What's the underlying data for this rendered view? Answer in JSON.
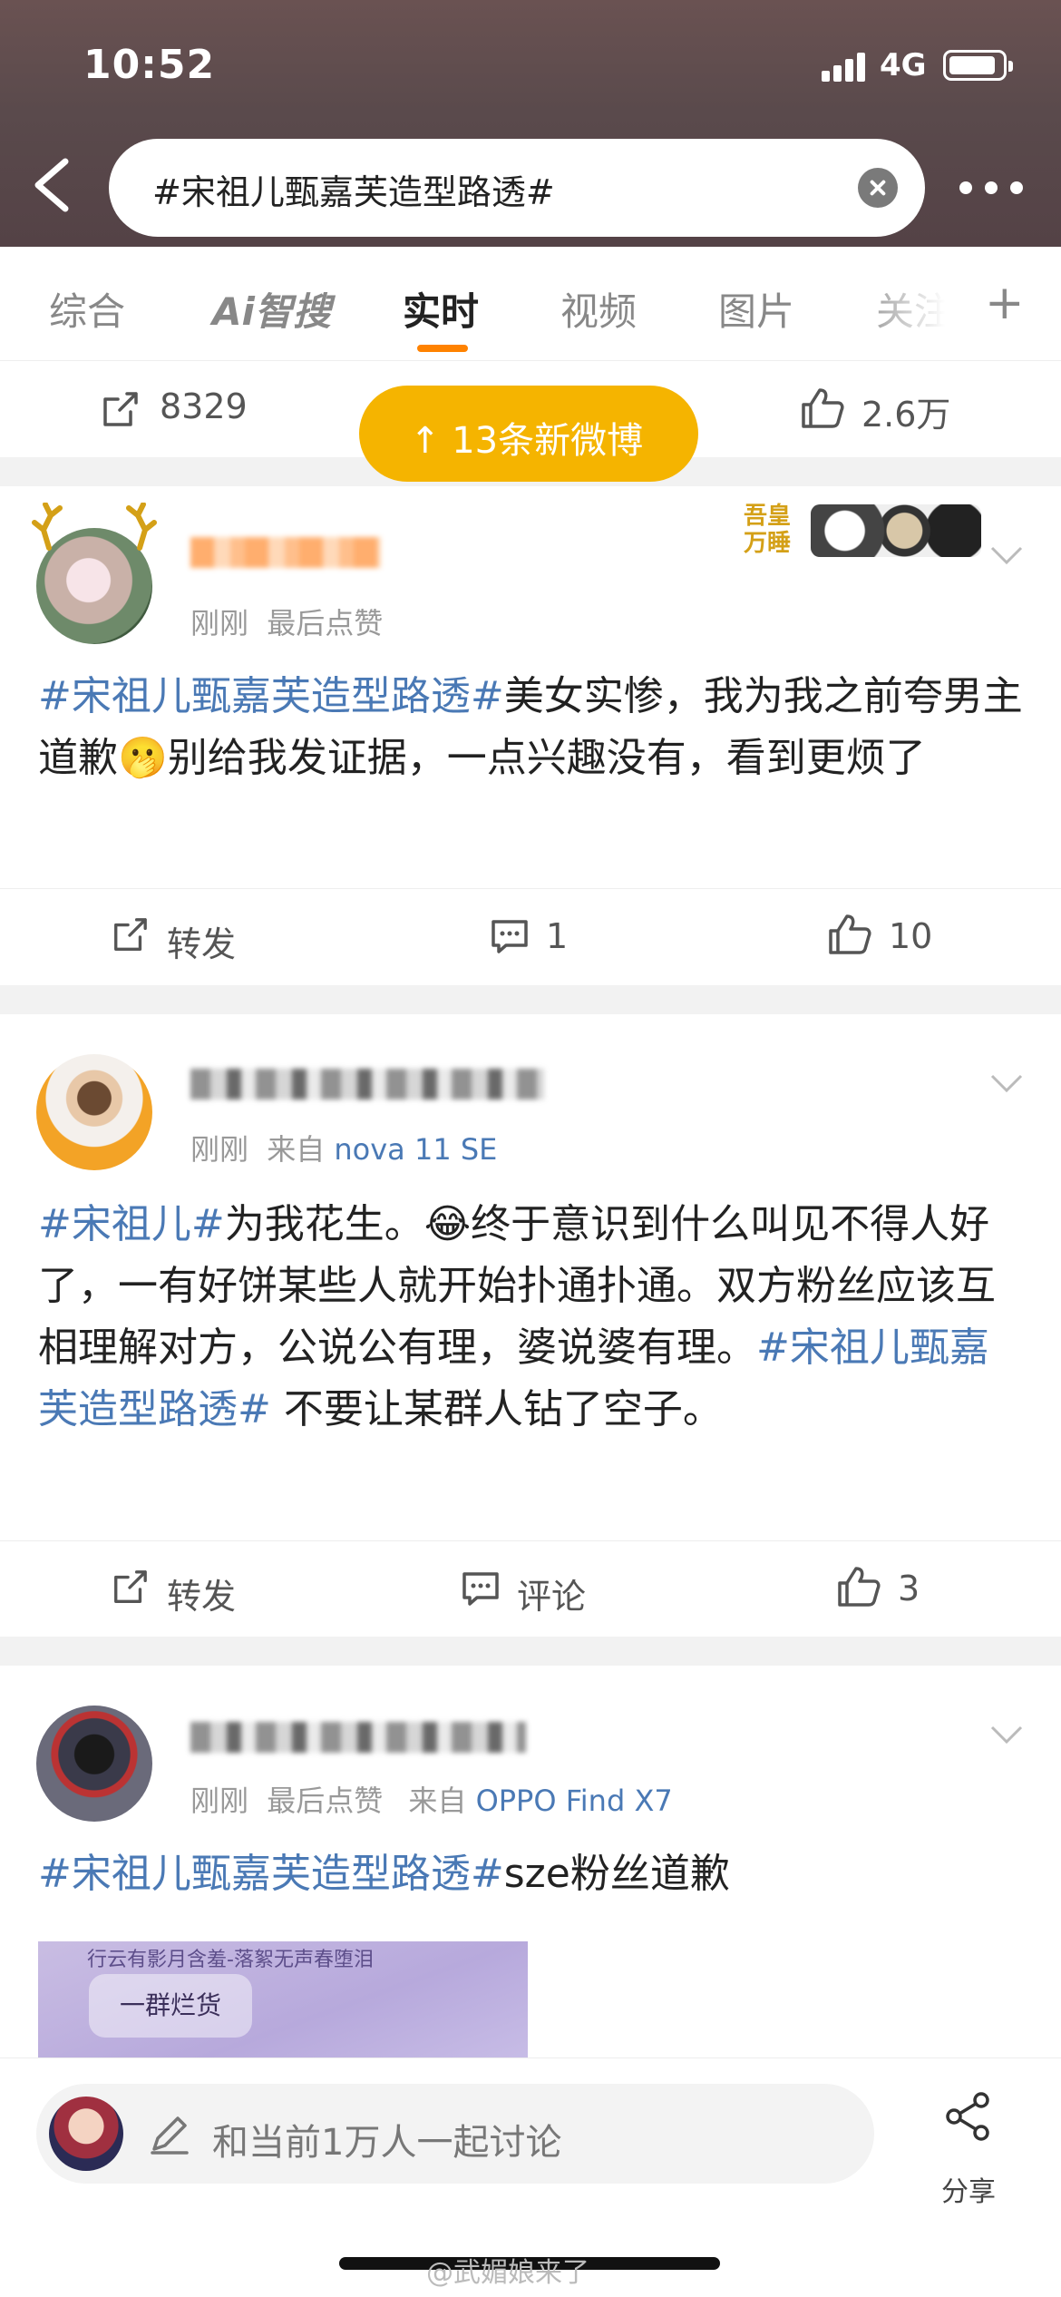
{
  "status_bar": {
    "time": "10:52",
    "network": "4G"
  },
  "search": {
    "query": "#宋祖儿甄嘉芙造型路透#"
  },
  "tabs": [
    {
      "label": "综合"
    },
    {
      "label": "Ai智搜"
    },
    {
      "label": "实时"
    },
    {
      "label": "视频"
    },
    {
      "label": "图片"
    },
    {
      "label": "关注"
    }
  ],
  "active_tab": "实时",
  "stats": {
    "reposts": "8329",
    "likes": "2.6万"
  },
  "new_posts_banner": "↑ 13条新微博",
  "sticker_text": "吾皇万睡",
  "posts": [
    {
      "time": "刚刚",
      "meta_extra": "最后点赞",
      "tag": "#宋祖儿甄嘉芙造型路透#",
      "text_after_tag": "美女实惨，我为我之前夸男主道歉🫢别给我发证据，一点兴趣没有，看到更烦了",
      "repost_label": "转发",
      "comment_count": "1",
      "like_count": "10"
    },
    {
      "time": "刚刚",
      "meta_from_label": "来自",
      "meta_device": "nova 11 SE",
      "tag1": "#宋祖儿#",
      "text1": "为我花生。😂终于意识到什么叫见不得人好了，一有好饼某些人就开始扑通扑通。双方粉丝应该互相理解对方，公说公有理，婆说婆有理。",
      "tag2": "#宋祖儿甄嘉芙造型路透#",
      "text2": " 不要让某群人钻了空子。",
      "repost_label": "转发",
      "comment_label": "评论",
      "like_count": "3"
    },
    {
      "time": "刚刚",
      "meta_extra": "最后点赞",
      "meta_from_label": "来自",
      "meta_device": "OPPO Find X7",
      "tag": "#宋祖儿甄嘉芙造型路透#",
      "text_after_tag": "sze粉丝道歉",
      "image_caption_top": "行云有影月含羞-落絮无声春堕泪",
      "image_caption_main": "一群烂货"
    }
  ],
  "composer": {
    "placeholder": "和当前1万人一起讨论",
    "share_label": "分享"
  },
  "watermark": "@武媚娘来了",
  "colors": {
    "accent": "#ff8200",
    "link": "#4a79b5",
    "banner": "#f5b400"
  }
}
